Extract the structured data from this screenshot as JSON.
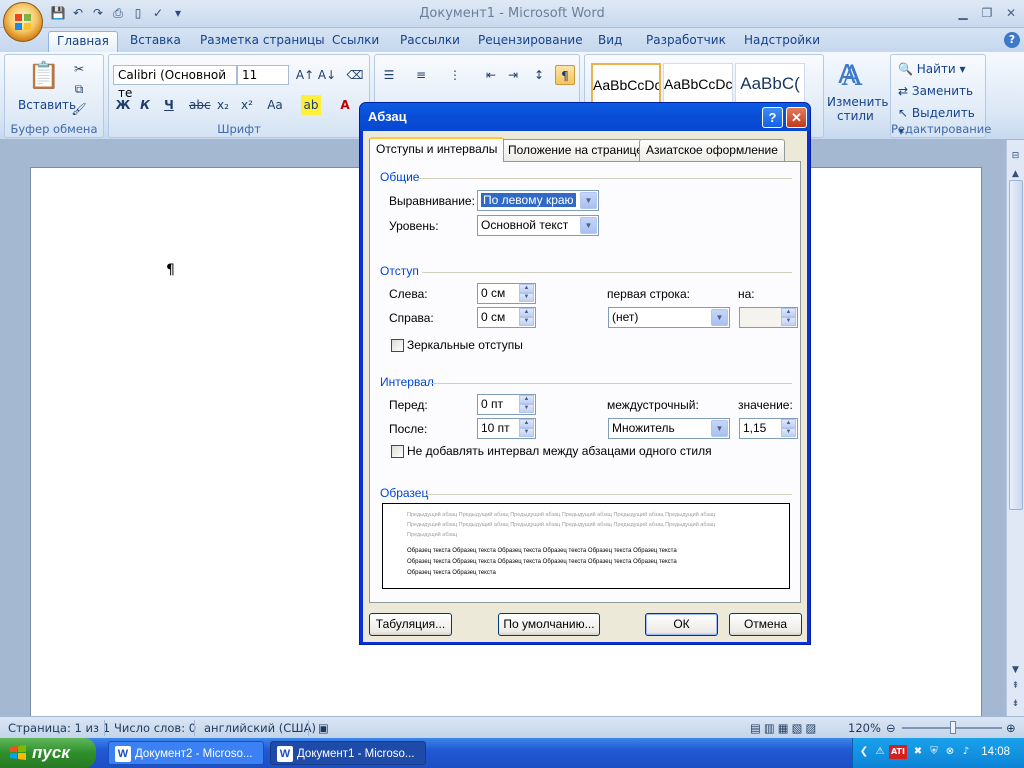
{
  "window": {
    "title": "Документ1 - Microsoft Word"
  },
  "tabs": [
    "Главная",
    "Вставка",
    "Разметка страницы",
    "Ссылки",
    "Рассылки",
    "Рецензирование",
    "Вид",
    "Разработчик",
    "Надстройки"
  ],
  "ribbon": {
    "clipboard": {
      "paste": "Вставить",
      "label": "Буфер обмена"
    },
    "font": {
      "name": "Calibri (Основной те",
      "size": "11",
      "label": "Шрифт"
    },
    "styles": {
      "cards": [
        "AaBbCcDc",
        "AaBbCcDc",
        "AaBbC("
      ],
      "change": "Изменить",
      "change2": "стили"
    },
    "editing": {
      "find": "Найти",
      "replace": "Заменить",
      "select": "Выделить",
      "label": "Редактирование"
    }
  },
  "document": {
    "pilcrow": "¶"
  },
  "status": {
    "page": "Страница: 1 из 1",
    "words": "Число слов: 0",
    "lang": "английский (США)",
    "zoom": "120%"
  },
  "taskbar": {
    "start": "пуск",
    "tasks": [
      "Документ2 - Microso...",
      "Документ1 - Microso..."
    ],
    "clock": "14:08"
  },
  "dialog": {
    "title": "Абзац",
    "help": "?",
    "tabs": [
      "Отступы и интервалы",
      "Положение на странице",
      "Азиатское оформление"
    ],
    "general": {
      "section": "Общие",
      "align_label": "Выравнивание:",
      "align_value": "По левому краю",
      "level_label": "Уровень:",
      "level_value": "Основной текст"
    },
    "indent": {
      "section": "Отступ",
      "left_label": "Слева:",
      "left_value": "0 см",
      "right_label": "Справа:",
      "right_value": "0 см",
      "first_line_label": "первая строка:",
      "first_line_value": "(нет)",
      "by_label": "на:",
      "by_value": "",
      "mirror": "Зеркальные отступы"
    },
    "spacing": {
      "section": "Интервал",
      "before_label": "Перед:",
      "before_value": "0 пт",
      "after_label": "После:",
      "after_value": "10 пт",
      "line_label": "междустрочный:",
      "line_value": "Множитель",
      "value_label": "значение:",
      "value": "1,15",
      "no_space": "Не добавлять интервал между абзацами одного стиля"
    },
    "preview": {
      "section": "Образец",
      "prev1": "Предыдущий абзац Предыдущий абзац Предыдущий абзац Предыдущий абзац Предыдущий абзац Предыдущий абзац",
      "prev2": "Предыдущий абзац Предыдущий абзац Предыдущий абзац Предыдущий абзац Предыдущий абзац Предыдущий абзац",
      "prev3": "Предыдущий абзац",
      "sample1": "Образец текста Образец текста Образец текста Образец текста Образец текста Образец текста",
      "sample2": "Образец текста Образец текста Образец текста Образец текста Образец текста Образец текста",
      "sample3": "Образец текста Образец текста"
    },
    "buttons": {
      "tabs": "Табуляция...",
      "default": "По умолчанию...",
      "ok": "ОК",
      "cancel": "Отмена"
    }
  }
}
